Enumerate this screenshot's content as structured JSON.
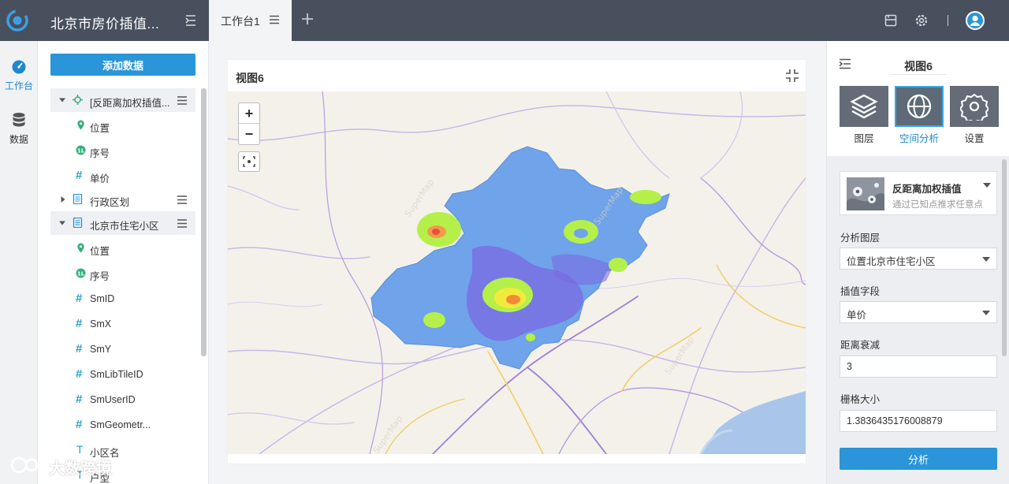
{
  "app": {
    "title": "北京市房价插值..."
  },
  "tabs": [
    {
      "label": "工作台1"
    }
  ],
  "rail": [
    {
      "label": "工作台"
    },
    {
      "label": "数据"
    }
  ],
  "data_panel": {
    "add_label": "添加数据",
    "rows": [
      {
        "type": "layer",
        "label": "[反距离加权插值...",
        "icon": "interpolation-icon"
      },
      {
        "type": "field",
        "label": "位置",
        "icon": "location-pin-icon"
      },
      {
        "type": "field",
        "label": "序号",
        "icon": "index-icon"
      },
      {
        "type": "field",
        "label": "单价",
        "icon": "#"
      },
      {
        "type": "dataset",
        "label": "行政区划",
        "icon": "table-icon"
      },
      {
        "type": "dataset",
        "label": "北京市住宅小区",
        "icon": "table-icon"
      },
      {
        "type": "field",
        "label": "位置",
        "icon": "location-pin-icon"
      },
      {
        "type": "field",
        "label": "序号",
        "icon": "index-icon"
      },
      {
        "type": "field",
        "label": "SmID",
        "icon": "#"
      },
      {
        "type": "field",
        "label": "SmX",
        "icon": "#"
      },
      {
        "type": "field",
        "label": "SmY",
        "icon": "#"
      },
      {
        "type": "field",
        "label": "SmLibTileID",
        "icon": "#"
      },
      {
        "type": "field",
        "label": "SmUserID",
        "icon": "#"
      },
      {
        "type": "field",
        "label": "SmGeometr...",
        "icon": "#"
      },
      {
        "type": "field",
        "label": "小区名",
        "icon": "T"
      },
      {
        "type": "field",
        "label": "户型",
        "icon": "T"
      }
    ],
    "watermark": "大数跨境"
  },
  "view": {
    "title": "视图6",
    "zoom_in": "+",
    "zoom_out": "−"
  },
  "right_panel": {
    "title": "视图6",
    "modes": [
      {
        "label": "图层"
      },
      {
        "label": "空间分析"
      },
      {
        "label": "设置"
      }
    ],
    "method": {
      "title": "反距离加权插值",
      "desc": "通过已知点推求任意点"
    },
    "fields": [
      {
        "label": "分析图层",
        "value": "位置北京市住宅小区",
        "kind": "select"
      },
      {
        "label": "插值字段",
        "value": "单价",
        "kind": "select"
      },
      {
        "label": "距离衰减",
        "value": "3",
        "kind": "input"
      },
      {
        "label": "栅格大小",
        "value": "1.3836435176008879",
        "kind": "input"
      }
    ],
    "run_label": "分析"
  },
  "colors": {
    "accent": "#2a95d8",
    "topbar": "#48505e",
    "active_mode": "#38a8e8"
  }
}
